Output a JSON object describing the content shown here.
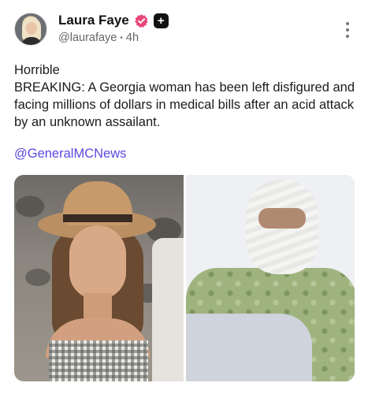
{
  "author": {
    "name": "Laura Faye",
    "handle": "@laurafaye",
    "time": "4h",
    "plus_badge": "+"
  },
  "icons": {
    "avatar": "profile-avatar",
    "verified": "verified-badge-icon",
    "plus": "plus-badge-icon",
    "more": "more-options-icon"
  },
  "post": {
    "line1": "Horrible",
    "line2": "BREAKING: A Georgia woman has been left disfigured and facing millions of dollars in medical bills after an acid attack by an unknown assailant.",
    "mention": "@GeneralMCNews"
  },
  "colors": {
    "verified": "#e8477a",
    "mention": "#5b49e0",
    "handle": "#666666"
  }
}
